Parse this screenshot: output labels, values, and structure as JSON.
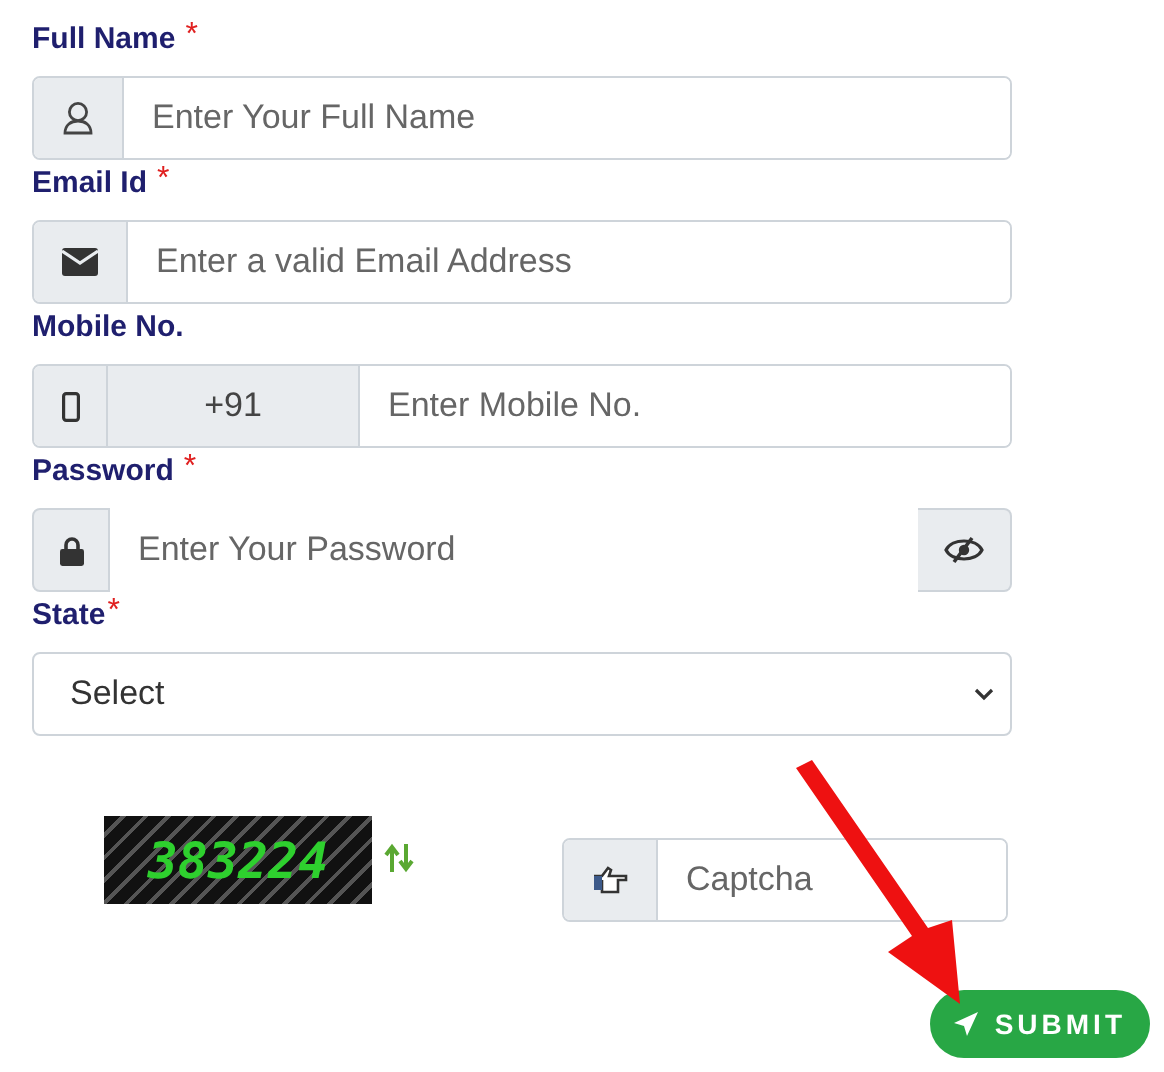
{
  "fields": [
    {
      "kind": "name",
      "label": "Full Name",
      "required_mark": "*",
      "placeholder": "Enter Your Full Name"
    },
    {
      "kind": "email",
      "label": "Email Id",
      "required_mark": "*",
      "placeholder": "Enter a valid Email Address"
    },
    {
      "kind": "mobile",
      "label": "Mobile No.",
      "prefix": "+91",
      "placeholder": "Enter Mobile No."
    },
    {
      "kind": "password",
      "label": "Password",
      "required_mark": "*",
      "placeholder": "Enter Your Password"
    },
    {
      "kind": "select",
      "label": "State",
      "required_mark": "*",
      "value": "Select"
    }
  ],
  "captcha": {
    "code": "383224",
    "placeholder": "Captcha"
  },
  "submit": {
    "label": "SUBMIT"
  }
}
